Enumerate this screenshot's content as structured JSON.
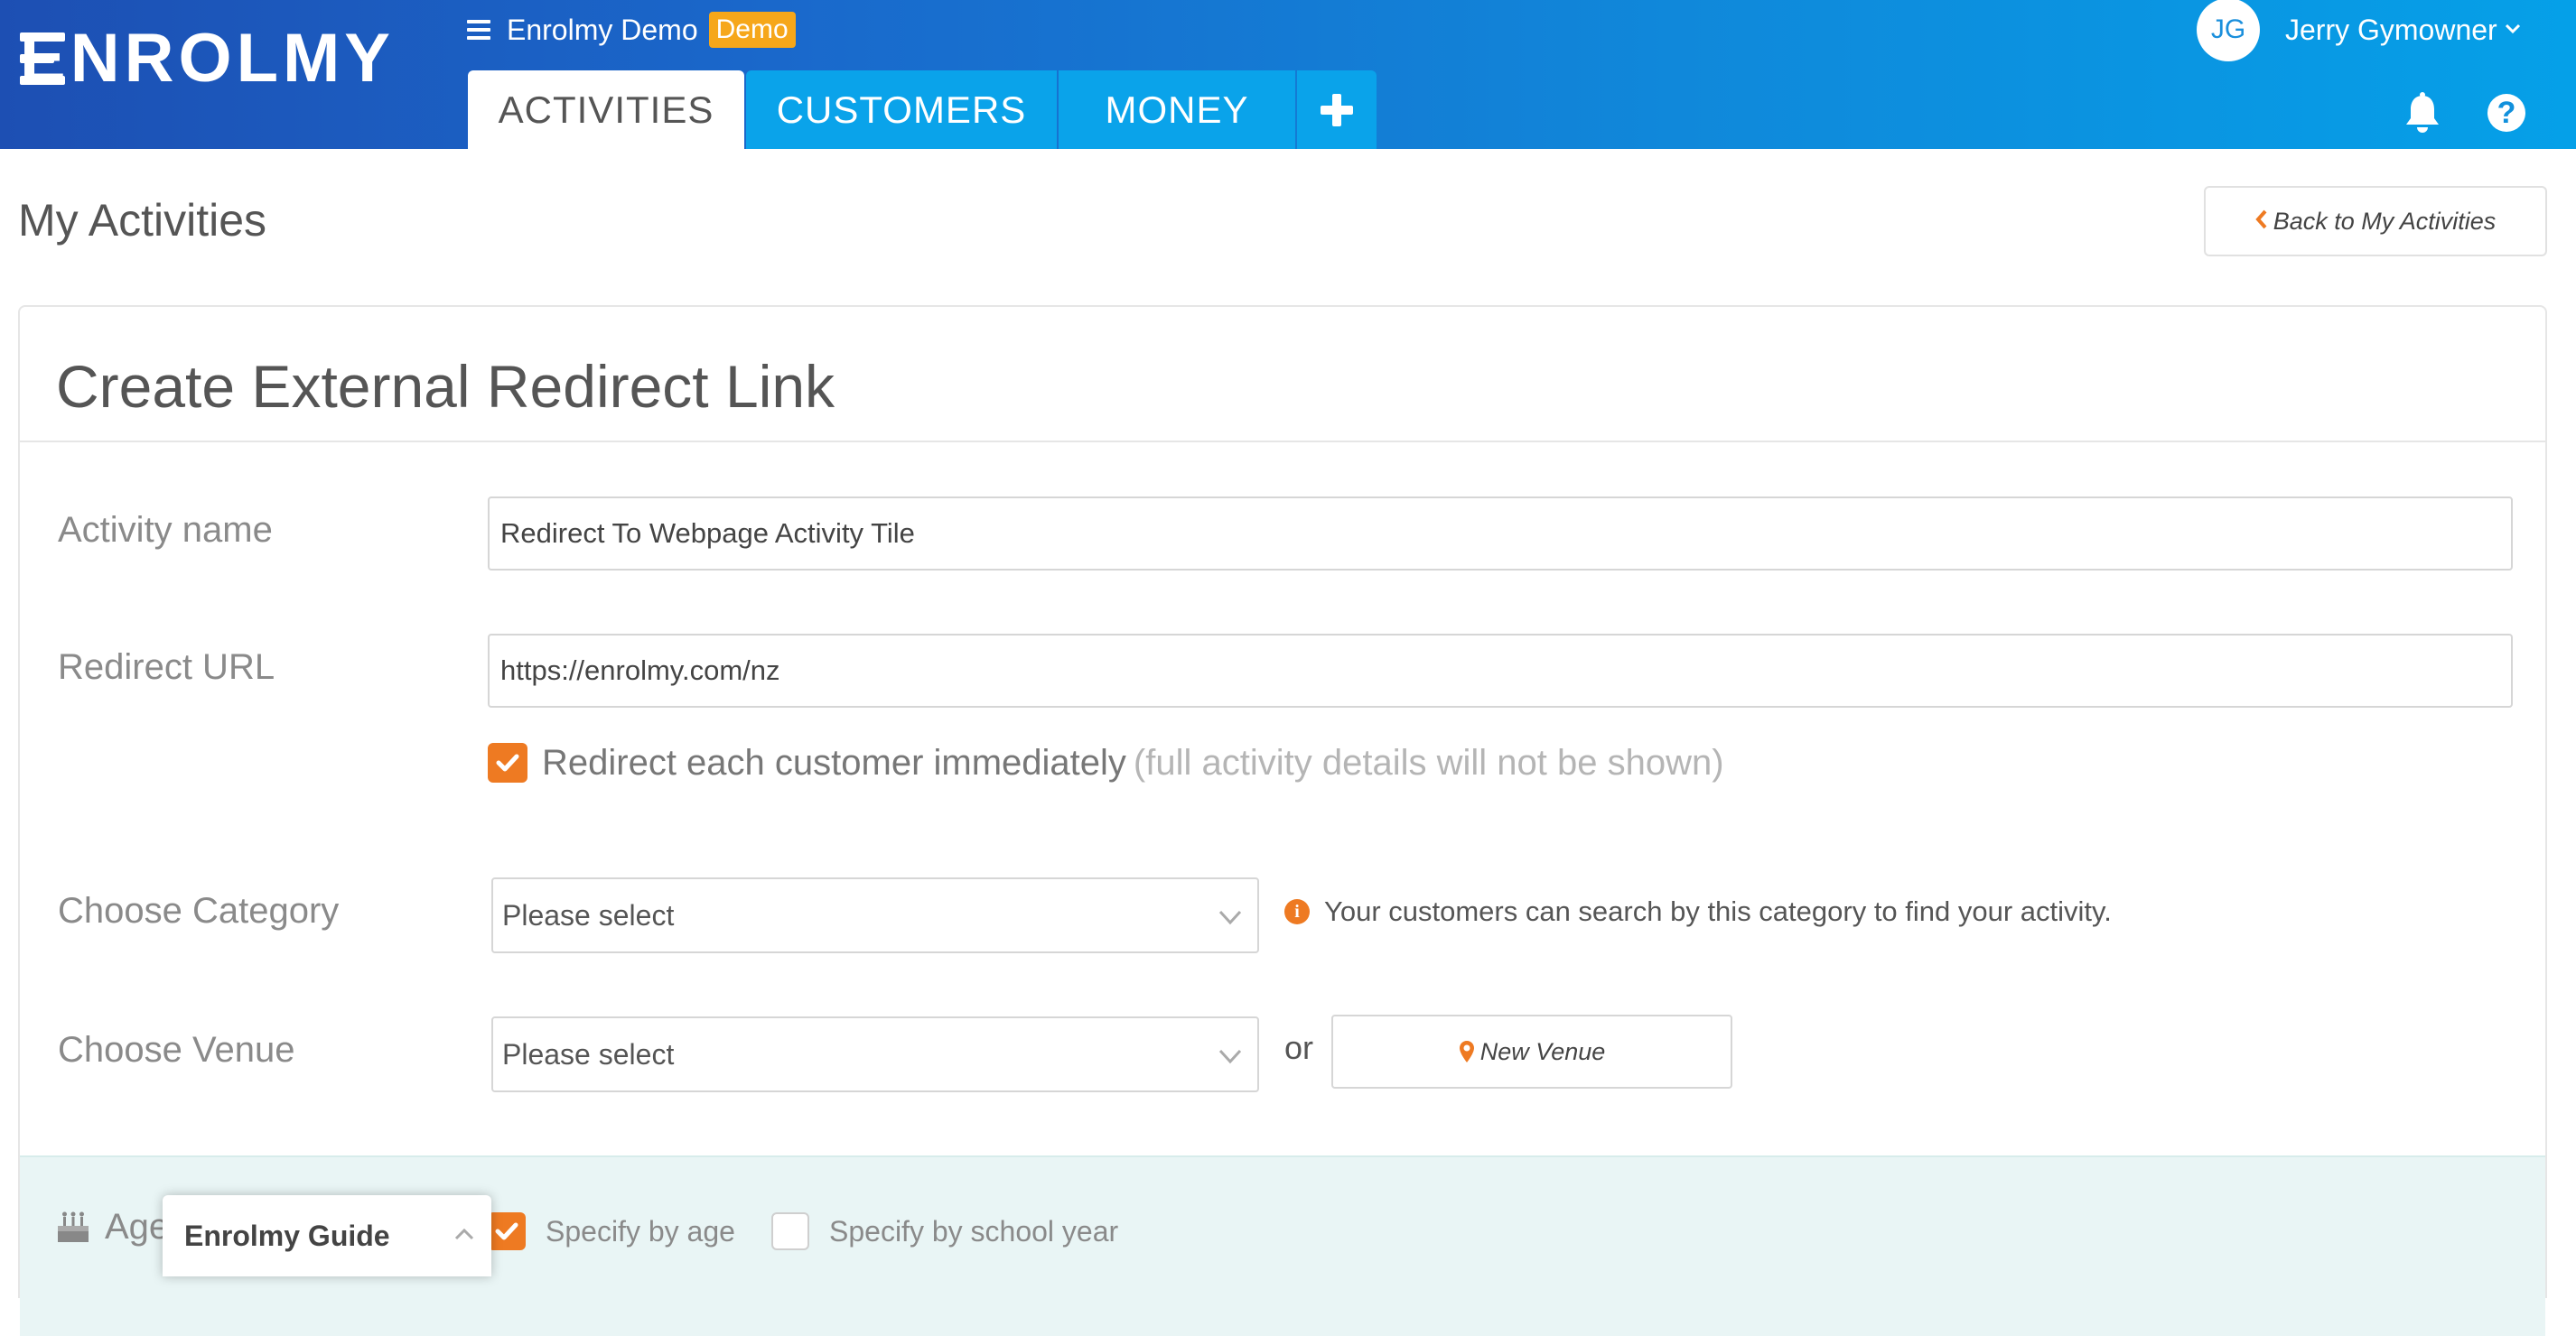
{
  "app": {
    "logo_text": "ENROLMY",
    "org_name": "Enrolmy Demo",
    "demo_badge": "Demo"
  },
  "nav": {
    "tabs": [
      {
        "label": "ACTIVITIES",
        "active": true
      },
      {
        "label": "CUSTOMERS",
        "active": false
      },
      {
        "label": "MONEY",
        "active": false
      }
    ],
    "add_tab_icon": "plus-icon"
  },
  "user": {
    "initials": "JG",
    "name": "Jerry Gymowner",
    "dropdown_icon": "chevron-down-icon",
    "notifications_icon": "bell-icon",
    "help_icon": "question-icon",
    "help_glyph": "?"
  },
  "page": {
    "title": "My Activities",
    "back_button": "Back to My Activities"
  },
  "form": {
    "title": "Create External Redirect Link",
    "activity_name": {
      "label": "Activity name",
      "value": "Redirect To Webpage Activity Tile"
    },
    "redirect_url": {
      "label": "Redirect URL",
      "value": "https://enrolmy.com/nz"
    },
    "redirect_immediately": {
      "checked": true,
      "label": "Redirect each customer immediately",
      "note": "(full activity details will not be shown)"
    },
    "category": {
      "label": "Choose Category",
      "selected": "Please select",
      "info": "Your customers can search by this category to find your activity."
    },
    "venue": {
      "label": "Choose Venue",
      "selected": "Please select",
      "or_text": "or",
      "new_venue_button": "New Venue"
    },
    "age": {
      "label": "Age",
      "specify_by_age": {
        "label": "Specify by age",
        "checked": true
      },
      "specify_by_school_year": {
        "label": "Specify by school year",
        "checked": false
      }
    }
  },
  "guide": {
    "title": "Enrolmy Guide"
  },
  "colors": {
    "header_start": "#1d4fb3",
    "header_end": "#05a0e8",
    "tab_inactive": "#0aa3ea",
    "accent_orange": "#ee7a22",
    "demo_badge": "#f6a71a",
    "age_section_bg": "#e9f5f5"
  }
}
